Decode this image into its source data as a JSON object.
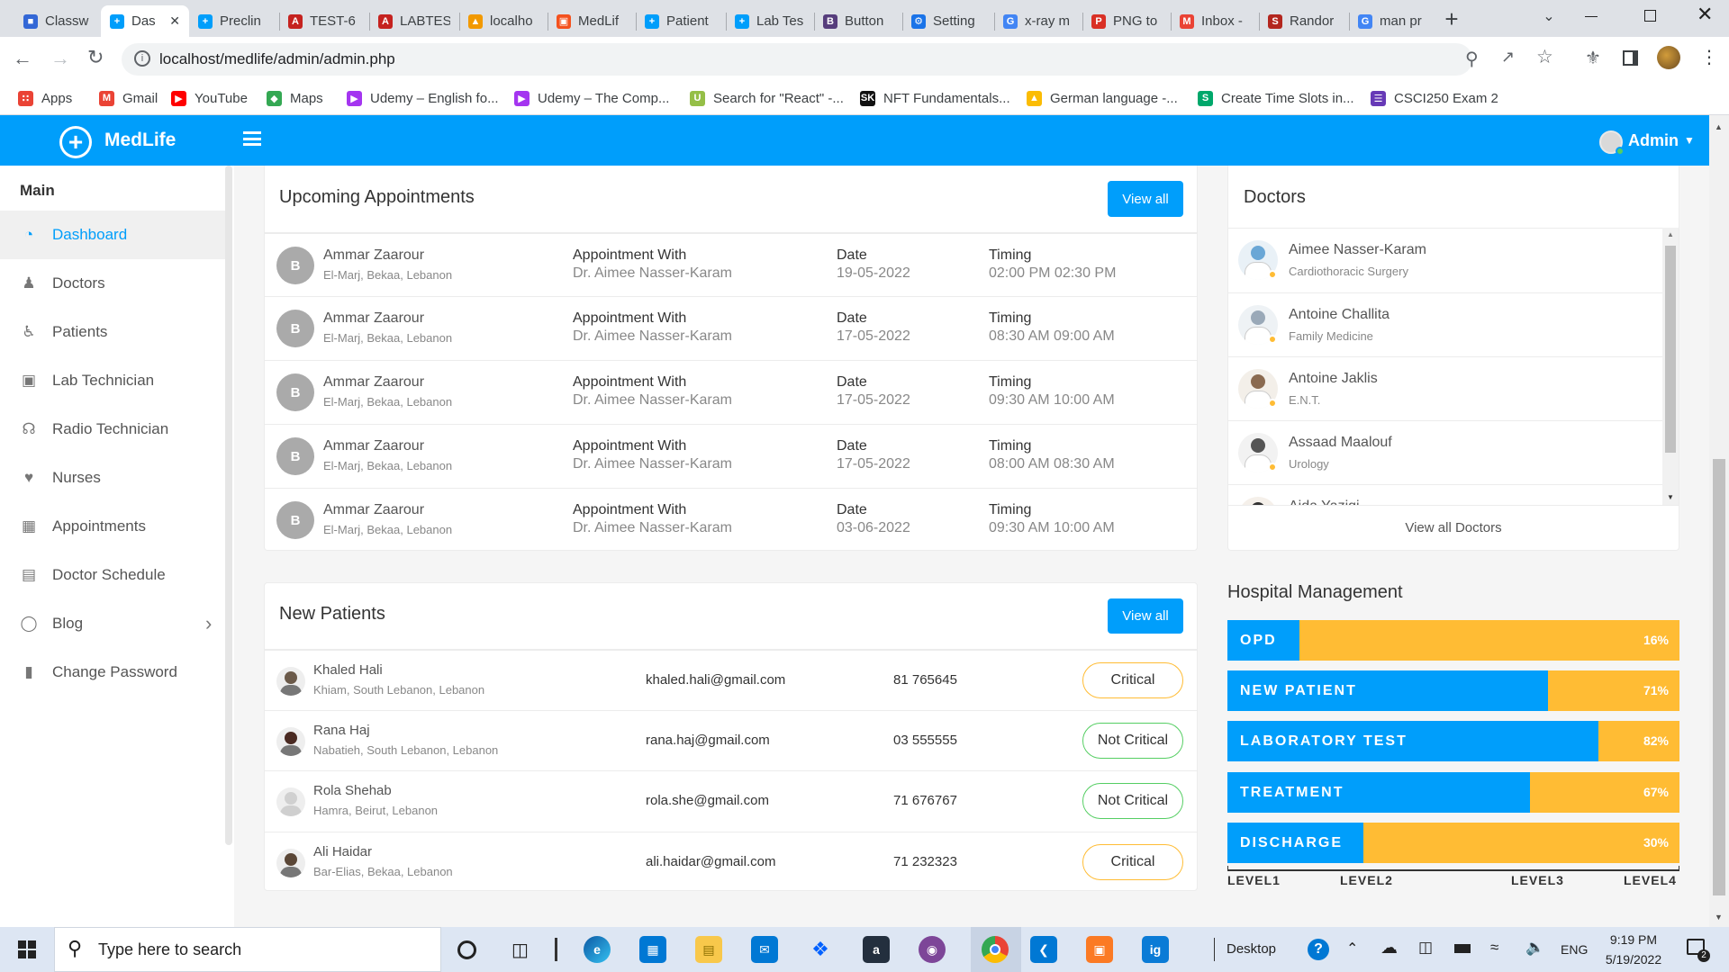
{
  "browser": {
    "tabs": [
      {
        "label": "Classw",
        "fav_color": "#3367d6",
        "fav": "■"
      },
      {
        "label": "Das",
        "fav_color": "#009efb",
        "fav": "+",
        "active": true
      },
      {
        "label": "Preclin",
        "fav_color": "#009efb",
        "fav": "+"
      },
      {
        "label": "TEST-6",
        "fav_color": "#c5221f",
        "fav": "A"
      },
      {
        "label": "LABTES",
        "fav_color": "#c5221f",
        "fav": "A"
      },
      {
        "label": "localho",
        "fav_color": "#f29900",
        "fav": "▲"
      },
      {
        "label": "MedLif",
        "fav_color": "#f4511e",
        "fav": "▣"
      },
      {
        "label": "Patient",
        "fav_color": "#009efb",
        "fav": "+"
      },
      {
        "label": "Lab Tes",
        "fav_color": "#009efb",
        "fav": "+"
      },
      {
        "label": "Button",
        "fav_color": "#563d7c",
        "fav": "B"
      },
      {
        "label": "Setting",
        "fav_color": "#1a73e8",
        "fav": "⚙"
      },
      {
        "label": "x-ray m",
        "fav_color": "#4285f4",
        "fav": "G"
      },
      {
        "label": "PNG to",
        "fav_color": "#d93025",
        "fav": "P"
      },
      {
        "label": "Inbox -",
        "fav_color": "#ea4335",
        "fav": "M"
      },
      {
        "label": "Randor",
        "fav_color": "#b3261e",
        "fav": "S"
      },
      {
        "label": "man pr",
        "fav_color": "#4285f4",
        "fav": "G"
      }
    ],
    "new_tab": "+",
    "url": "localhost/medlife/admin/admin.php",
    "bookmarks": [
      {
        "label": "Apps",
        "color": "#ea4335",
        "glyph": "∷"
      },
      {
        "label": "Gmail",
        "color": "#ea4335",
        "glyph": "M"
      },
      {
        "label": "YouTube",
        "color": "#ff0000",
        "glyph": "▶"
      },
      {
        "label": "Maps",
        "color": "#34a853",
        "glyph": "◆"
      },
      {
        "label": "Udemy – English fo...",
        "color": "#a435f0",
        "glyph": "▶"
      },
      {
        "label": "Udemy – The Comp...",
        "color": "#a435f0",
        "glyph": "▶"
      },
      {
        "label": "Search for \"React\" -...",
        "color": "#95bf47",
        "glyph": "U"
      },
      {
        "label": "NFT Fundamentals...",
        "color": "#111111",
        "glyph": "SK"
      },
      {
        "label": "German language -...",
        "color": "#fbbc04",
        "glyph": "▲"
      },
      {
        "label": "Create Time Slots in...",
        "color": "#00a86b",
        "glyph": "S"
      },
      {
        "label": "CSCI250 Exam 2",
        "color": "#673ab7",
        "glyph": "☰"
      }
    ]
  },
  "header": {
    "brand": "MedLife",
    "user": "Admin"
  },
  "sidebar": {
    "section": "Main",
    "items": [
      {
        "label": "Dashboard",
        "icon": "◔",
        "active": true
      },
      {
        "label": "Doctors",
        "icon": "♟"
      },
      {
        "label": "Patients",
        "icon": "♿"
      },
      {
        "label": "Lab Technician",
        "icon": "▣"
      },
      {
        "label": "Radio Technician",
        "icon": "☊"
      },
      {
        "label": "Nurses",
        "icon": "♥"
      },
      {
        "label": "Appointments",
        "icon": "▦"
      },
      {
        "label": "Doctor Schedule",
        "icon": "▤"
      },
      {
        "label": "Blog",
        "icon": "◯",
        "chevron": "›"
      },
      {
        "label": "Change Password",
        "icon": "▮"
      }
    ]
  },
  "appointments": {
    "title": "Upcoming Appointments",
    "view_all": "View all",
    "with_label": "Appointment With",
    "date_label": "Date",
    "timing_label": "Timing",
    "rows": [
      {
        "initial": "B",
        "name": "Ammar Zaarour",
        "location": "El-Marj, Bekaa, Lebanon",
        "doctor": "Dr. Aimee Nasser-Karam",
        "date": "19-05-2022",
        "timing": "02:00 PM 02:30 PM"
      },
      {
        "initial": "B",
        "name": "Ammar Zaarour",
        "location": "El-Marj, Bekaa, Lebanon",
        "doctor": "Dr. Aimee Nasser-Karam",
        "date": "17-05-2022",
        "timing": "08:30 AM 09:00 AM"
      },
      {
        "initial": "B",
        "name": "Ammar Zaarour",
        "location": "El-Marj, Bekaa, Lebanon",
        "doctor": "Dr. Aimee Nasser-Karam",
        "date": "17-05-2022",
        "timing": "09:30 AM 10:00 AM"
      },
      {
        "initial": "B",
        "name": "Ammar Zaarour",
        "location": "El-Marj, Bekaa, Lebanon",
        "doctor": "Dr. Aimee Nasser-Karam",
        "date": "17-05-2022",
        "timing": "08:00 AM 08:30 AM"
      },
      {
        "initial": "B",
        "name": "Ammar Zaarour",
        "location": "El-Marj, Bekaa, Lebanon",
        "doctor": "Dr. Aimee Nasser-Karam",
        "date": "03-06-2022",
        "timing": "09:30 AM 10:00 AM"
      }
    ]
  },
  "doctors": {
    "title": "Doctors",
    "view_all": "View all Doctors",
    "list": [
      {
        "name": "Aimee Nasser-Karam",
        "specialty": "Cardiothoracic Surgery"
      },
      {
        "name": "Antoine Challita",
        "specialty": "Family Medicine"
      },
      {
        "name": "Antoine Jaklis",
        "specialty": "E.N.T."
      },
      {
        "name": "Assaad Maalouf",
        "specialty": "Urology"
      },
      {
        "name": "Aida Yazigi",
        "specialty": ""
      }
    ]
  },
  "patients": {
    "title": "New Patients",
    "view_all": "View all",
    "rows": [
      {
        "name": "Khaled Hali",
        "location": "Khiam, South Lebanon, Lebanon",
        "email": "khaled.hali@gmail.com",
        "phone": "81 765645",
        "status": "Critical",
        "critical": true
      },
      {
        "name": "Rana Haj",
        "location": "Nabatieh, South Lebanon, Lebanon",
        "email": "rana.haj@gmail.com",
        "phone": "03 555555",
        "status": "Not Critical",
        "critical": false
      },
      {
        "name": "Rola Shehab",
        "location": "Hamra, Beirut, Lebanon",
        "email": "rola.she@gmail.com",
        "phone": "71 676767",
        "status": "Not Critical",
        "critical": false
      },
      {
        "name": "Ali Haidar",
        "location": "Bar-Elias, Bekaa, Lebanon",
        "email": "ali.haidar@gmail.com",
        "phone": "71 232323",
        "status": "Critical",
        "critical": true
      }
    ]
  },
  "hospital_management": {
    "title": "Hospital Management",
    "bars": [
      {
        "label": "OPD",
        "percent_label": "16%",
        "fill": 0.16
      },
      {
        "label": "NEW PATIENT",
        "percent_label": "71%",
        "fill": 0.71
      },
      {
        "label": "LABORATORY TEST",
        "percent_label": "82%",
        "fill": 0.82
      },
      {
        "label": "TREATMENT",
        "percent_label": "67%",
        "fill": 0.67
      },
      {
        "label": "DISCHARGE",
        "percent_label": "30%",
        "fill": 0.3
      }
    ],
    "levels": [
      "LEVEL1",
      "LEVEL2",
      "LEVEL3",
      "LEVEL4"
    ]
  },
  "taskbar": {
    "search_placeholder": "Type here to search",
    "desktop": "Desktop",
    "language": "ENG",
    "time": "9:19 PM",
    "date": "5/19/2022"
  },
  "colors": {
    "primary": "#009efb",
    "warning": "#ffbc34",
    "success": "#55ce63"
  }
}
